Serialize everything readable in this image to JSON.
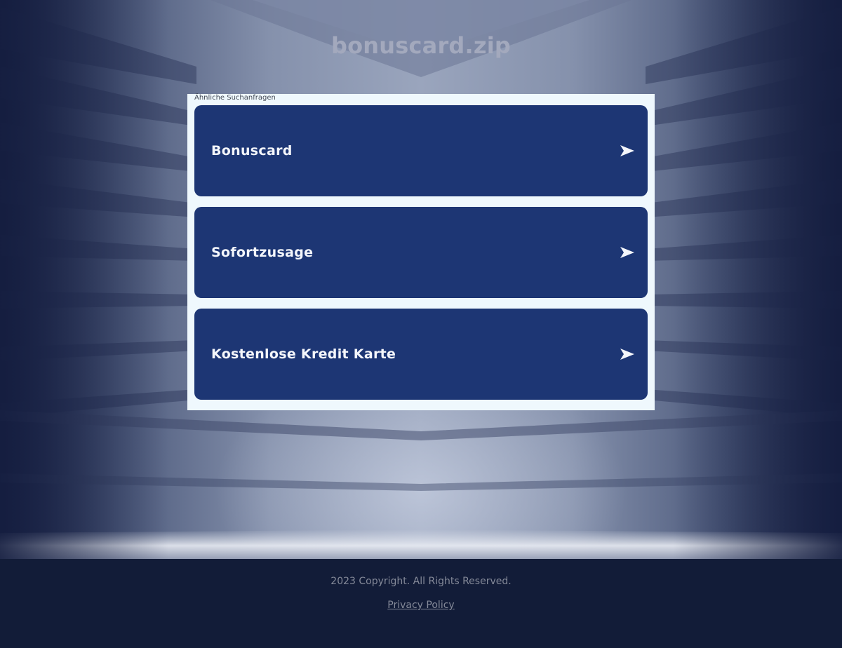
{
  "site": {
    "title": "bonuscard.zip"
  },
  "related": {
    "heading": "Ähnliche Suchanfragen",
    "items": [
      {
        "label": "Bonuscard",
        "icon": "arrow-right-icon"
      },
      {
        "label": "Sofortzusage",
        "icon": "arrow-right-icon"
      },
      {
        "label": "Kostenlose Kredit Karte",
        "icon": "arrow-right-icon"
      }
    ]
  },
  "footer": {
    "copyright": "2023 Copyright. All Rights Reserved.",
    "privacy_label": "Privacy Policy "
  },
  "colors": {
    "result_bg": "#1d3674",
    "panel_bg": "#eff8fd",
    "footer_bg": "#121c38",
    "title_text": "#a3a9bd"
  }
}
